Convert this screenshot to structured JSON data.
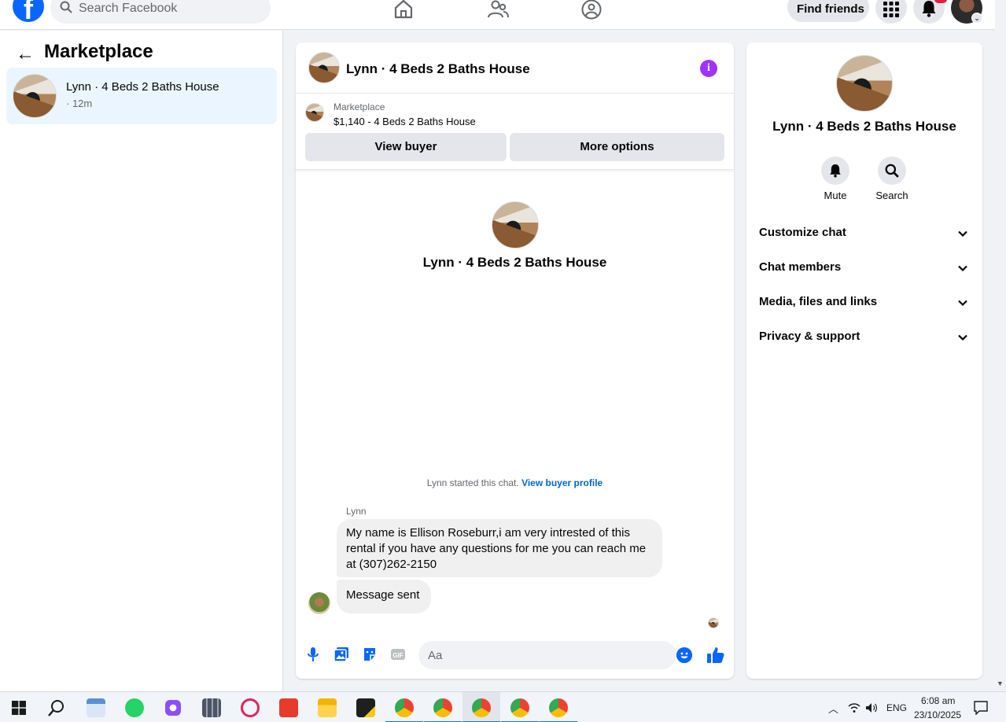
{
  "topbar": {
    "search_placeholder": "Search Facebook",
    "find_friends_label": "Find friends"
  },
  "sidebar": {
    "title": "Marketplace",
    "conversations": [
      {
        "name": "Lynn · 4 Beds 2 Baths House",
        "time": "· 12m"
      }
    ]
  },
  "chat": {
    "header_name": "Lynn · 4 Beds 2 Baths House",
    "listing_source": "Marketplace",
    "listing_title": "$1,140 - 4 Beds 2 Baths House",
    "view_buyer_label": "View buyer",
    "more_options_label": "More options",
    "intro_name": "Lynn · 4 Beds 2 Baths House",
    "started_text": "Lynn started this chat.",
    "view_profile_link": "View buyer profile",
    "sender_name": "Lynn",
    "messages": [
      {
        "text": "My name is Ellison Roseburr,i am very intrested of this rental if you have any questions for me you can reach me at (307)262-2150"
      },
      {
        "text": "Message sent"
      }
    ],
    "composer_placeholder": "Aa"
  },
  "details": {
    "name": "Lynn · 4 Beds 2 Baths House",
    "mute_label": "Mute",
    "search_label": "Search",
    "sections": [
      "Customize chat",
      "Chat members",
      "Media, files and links",
      "Privacy & support"
    ]
  },
  "taskbar": {
    "language": "ENG",
    "time": "6:08 am",
    "date": "23/10/2025"
  },
  "colors": {
    "accent": "#0866ff",
    "info": "#a033ff",
    "selected_bg": "#ebf5ff"
  }
}
